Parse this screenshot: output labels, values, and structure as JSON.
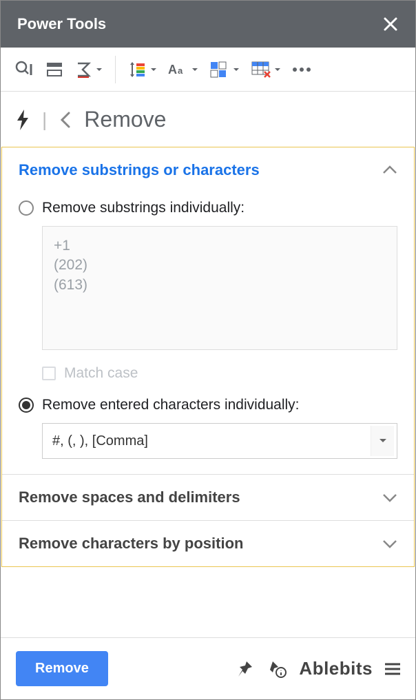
{
  "titlebar": {
    "title": "Power Tools"
  },
  "breadcrumb": {
    "title": "Remove"
  },
  "sections": {
    "s1": {
      "title": "Remove substrings or characters",
      "optA": "Remove substrings individually:",
      "textarea": "+1\n(202)\n(613)",
      "matchcase": "Match case",
      "optB": "Remove entered characters individually:",
      "select_value": "#, (, ), [Comma]"
    },
    "s2": {
      "title": "Remove spaces and delimiters"
    },
    "s3": {
      "title": "Remove characters by position"
    }
  },
  "footer": {
    "action": "Remove",
    "brand": "Ablebits"
  }
}
